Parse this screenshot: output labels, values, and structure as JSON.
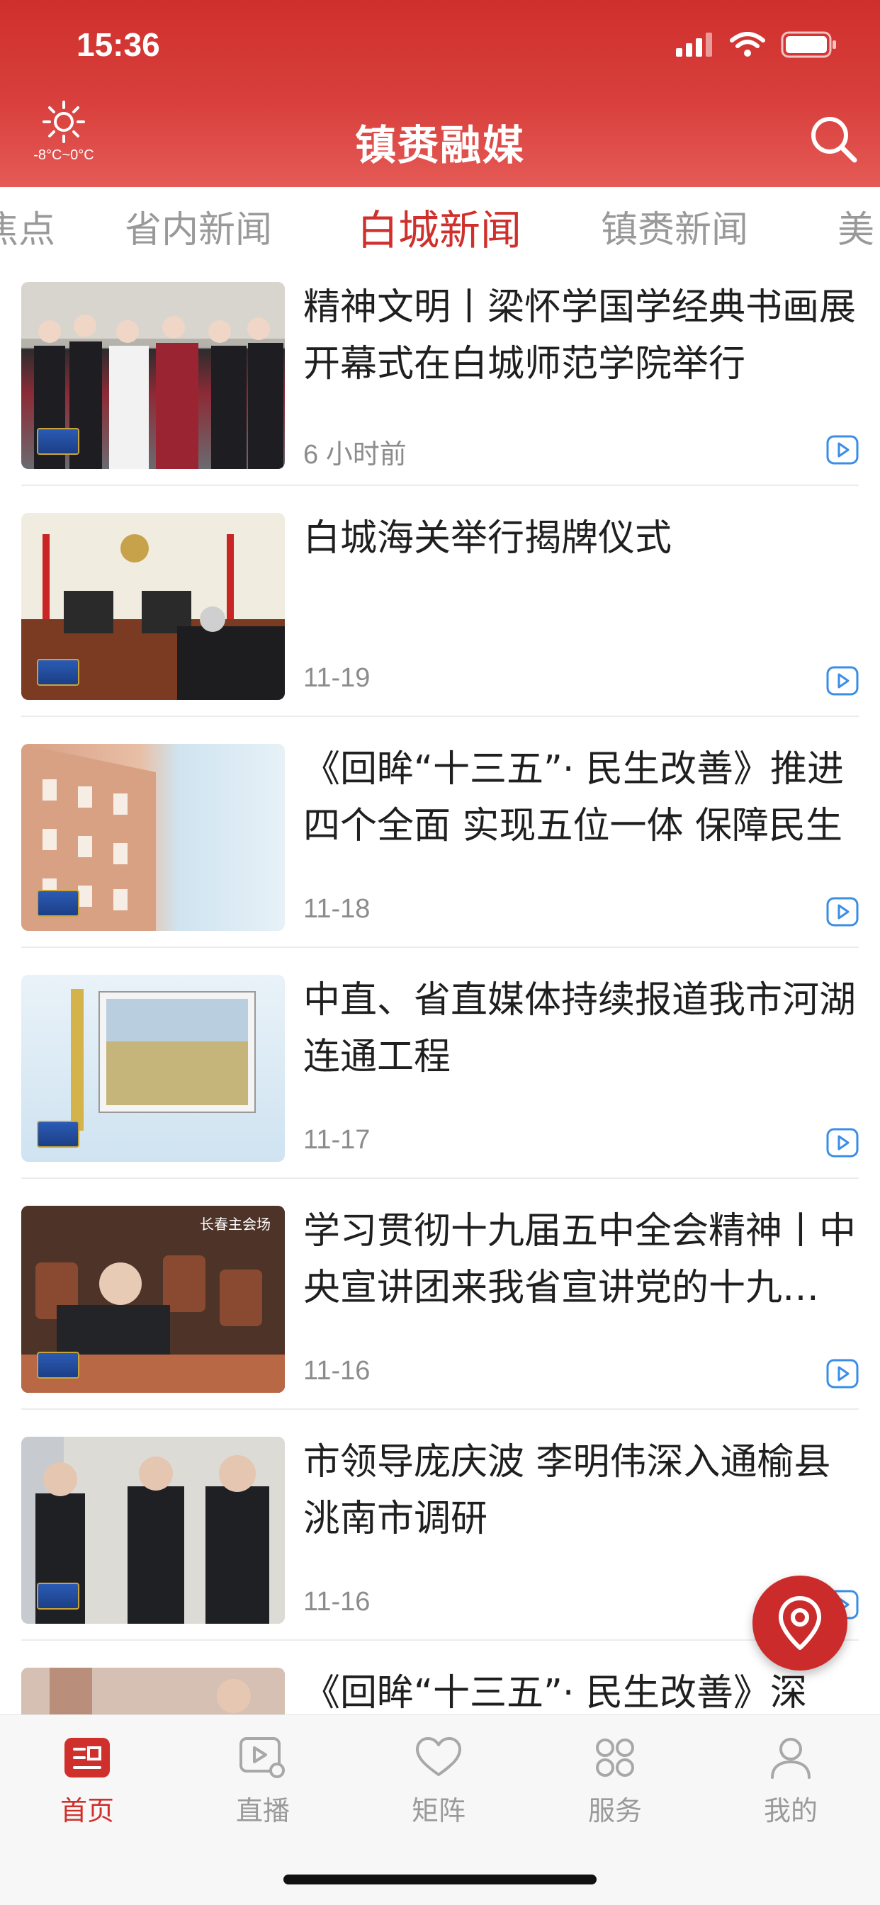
{
  "status": {
    "time": "15:36"
  },
  "header": {
    "weather_temp": "-8°C~0°C",
    "title": "镇赉融媒"
  },
  "tabs": [
    {
      "label": "焦点"
    },
    {
      "label": "省内新闻"
    },
    {
      "label": "白城新闻",
      "active": true
    },
    {
      "label": "镇赉新闻"
    },
    {
      "label": "美"
    }
  ],
  "news": [
    {
      "title": "精神文明丨梁怀学国学经典书画展开幕式在白城师范学院举行",
      "date": "6 小时前",
      "has_video": true,
      "thumb_icon": "people-standing-scene"
    },
    {
      "title": "白城海关举行揭牌仪式",
      "date": "11-19",
      "has_video": true,
      "thumb_icon": "meeting-room-scene"
    },
    {
      "title": "《回眸“十三五”· 民生改善》推进四个全面 实现五位一体 保障民生",
      "date": "11-18",
      "has_video": true,
      "thumb_icon": "apartment-building-scene"
    },
    {
      "title": "中直、省直媒体持续报道我市河湖连通工程",
      "date": "11-17",
      "has_video": true,
      "thumb_icon": "newspaper-field-scene"
    },
    {
      "title": "学习贯彻十九届五中全会精神丨中央宣讲团来我省宣讲党的十九届五中全会精神",
      "date": "11-16",
      "has_video": true,
      "thumb_icon": "conference-hall-scene"
    },
    {
      "title": "市领导庞庆波  李明伟深入通榆县洮南市调研",
      "date": "11-16",
      "has_video": true,
      "thumb_icon": "officials-visit-scene"
    },
    {
      "title": "《回眸“十三五”· 民生改善》深",
      "date": "",
      "has_video": false,
      "thumb_icon": "indoor-scene"
    }
  ],
  "thumb_overlay": {
    "partial_text": "长春主会场"
  },
  "tabbar": [
    {
      "label": "首页",
      "icon": "news-home-icon",
      "active": true
    },
    {
      "label": "直播",
      "icon": "live-play-icon"
    },
    {
      "label": "矩阵",
      "icon": "heart-icon"
    },
    {
      "label": "服务",
      "icon": "services-grid-icon"
    },
    {
      "label": "我的",
      "icon": "profile-icon"
    }
  ],
  "colors": {
    "brand_red": "#d0302c",
    "header_red": "#cf2f2c",
    "link_blue": "#3a8ee6",
    "muted": "#9a9a9a"
  }
}
